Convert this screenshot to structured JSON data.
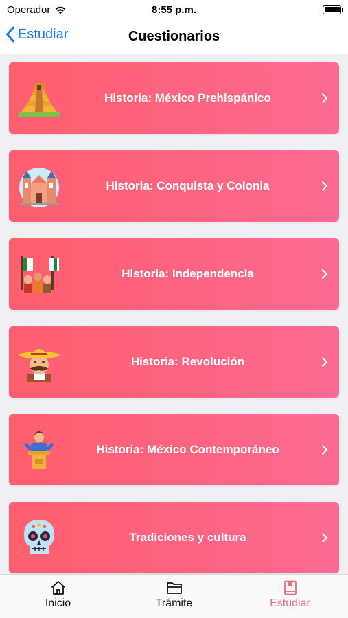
{
  "status": {
    "carrier": "Operador",
    "time": "8:55 p.m."
  },
  "nav": {
    "back_label": "Estudiar",
    "title": "Cuestionarios"
  },
  "cards": [
    {
      "label": "Historia: México Prehispánico",
      "icon": "pyramid-icon"
    },
    {
      "label": "Historia: Conquista y Colonia",
      "icon": "cathedral-icon"
    },
    {
      "label": "Historia: Independencia",
      "icon": "flags-crowd-icon"
    },
    {
      "label": "Historia: Revolución",
      "icon": "sombrero-man-icon"
    },
    {
      "label": "Historia: México Contemporáneo",
      "icon": "politician-podium-icon"
    },
    {
      "label": "Tradiciones y cultura",
      "icon": "sugar-skull-icon"
    }
  ],
  "tabs": [
    {
      "label": "Inicio",
      "icon": "home-icon",
      "active": false
    },
    {
      "label": "Trámite",
      "icon": "folder-icon",
      "active": false
    },
    {
      "label": "Estudiar",
      "icon": "book-icon",
      "active": true
    }
  ],
  "colors": {
    "accent": "#1a7cf5",
    "card_start": "#ff5f6d",
    "card_end": "#fc6a92",
    "tab_active": "#f06a7e"
  }
}
